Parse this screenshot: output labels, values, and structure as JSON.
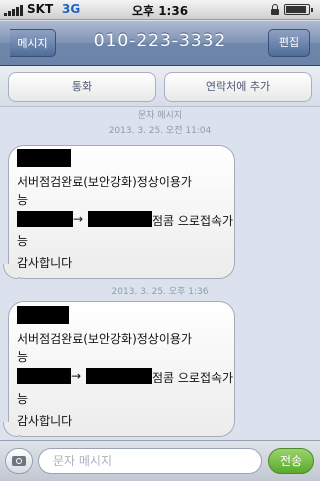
{
  "status_bar": {
    "carrier": "SKT",
    "network": "3G",
    "time": "오후 1:36",
    "battery_level": 0.9
  },
  "nav": {
    "back_label": "메시지",
    "title": "010-223-3332",
    "edit_label": "편집"
  },
  "actions": {
    "call_label": "통화",
    "add_contact_label": "연락처에 추가"
  },
  "conversation": {
    "header": "문자 메시지",
    "messages": [
      {
        "timestamp": "2013. 3. 25. 오전 11:04",
        "line1": "서버점검완료(보안강화)정상이용가",
        "line1b": "능",
        "line2_suffix": "점콤 으로접속가",
        "line2b": "능",
        "line3": "감사합니다",
        "arrow": "→"
      },
      {
        "timestamp": "2013. 3. 25. 오후 1:36",
        "line1": "서버점검완료(보안강화)정상이용가",
        "line1b": "능",
        "line2_suffix": "점콤 으로접속가",
        "line2b": "능",
        "line3": "감사합니다",
        "arrow": "→"
      }
    ]
  },
  "input_bar": {
    "placeholder": "문자 메시지",
    "send_label": "전송",
    "camera_icon": "camera-icon"
  },
  "colors": {
    "send_green": "#5aa92f",
    "nav_blue": "#6e86ab",
    "background": "#dbe2ed"
  }
}
